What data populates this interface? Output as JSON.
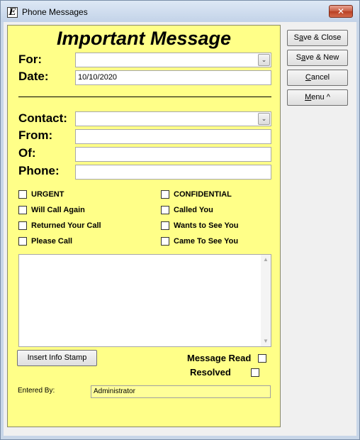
{
  "window": {
    "title": "Phone Messages",
    "icon_letter": "E",
    "close_glyph": "✕"
  },
  "form": {
    "heading": "Important Message",
    "for_label": "For:",
    "for_value": "",
    "date_label": "Date:",
    "date_value": "10/10/2020",
    "contact_label": "Contact:",
    "contact_value": "",
    "from_label": "From:",
    "from_value": "",
    "of_label": "Of:",
    "of_value": "",
    "phone_label": "Phone:",
    "phone_value": "",
    "checkboxes": [
      {
        "label": "URGENT",
        "checked": false
      },
      {
        "label": "Will Call Again",
        "checked": false
      },
      {
        "label": "Returned Your Call",
        "checked": false
      },
      {
        "label": "Please Call",
        "checked": false
      },
      {
        "label": "CONFIDENTIAL",
        "checked": false
      },
      {
        "label": "Called You",
        "checked": false
      },
      {
        "label": "Wants to See You",
        "checked": false
      },
      {
        "label": "Came To See You",
        "checked": false
      }
    ],
    "message_body": "",
    "insert_stamp_label": "Insert Info Stamp",
    "message_read_label": "Message Read",
    "message_read_checked": false,
    "resolved_label": "Resolved",
    "resolved_checked": false,
    "entered_by_label": "Entered By:",
    "entered_by_value": "Administrator"
  },
  "side_buttons": {
    "save_close_pre": "S",
    "save_close_ul": "a",
    "save_close_post": "ve & Close",
    "save_new_pre": "S",
    "save_new_ul": "a",
    "save_new_post": "ve & New",
    "cancel_pre": "",
    "cancel_ul": "C",
    "cancel_post": "ancel",
    "menu_pre": "",
    "menu_ul": "M",
    "menu_post": "enu ^"
  },
  "icons": {
    "dropdown": "chevron-down-icon",
    "scroll_up": "scroll-up-icon",
    "scroll_down": "scroll-down-icon"
  },
  "colors": {
    "form_background": "#ffff88",
    "window_frame": "#c8d6e8",
    "close_button": "#c75a40"
  }
}
